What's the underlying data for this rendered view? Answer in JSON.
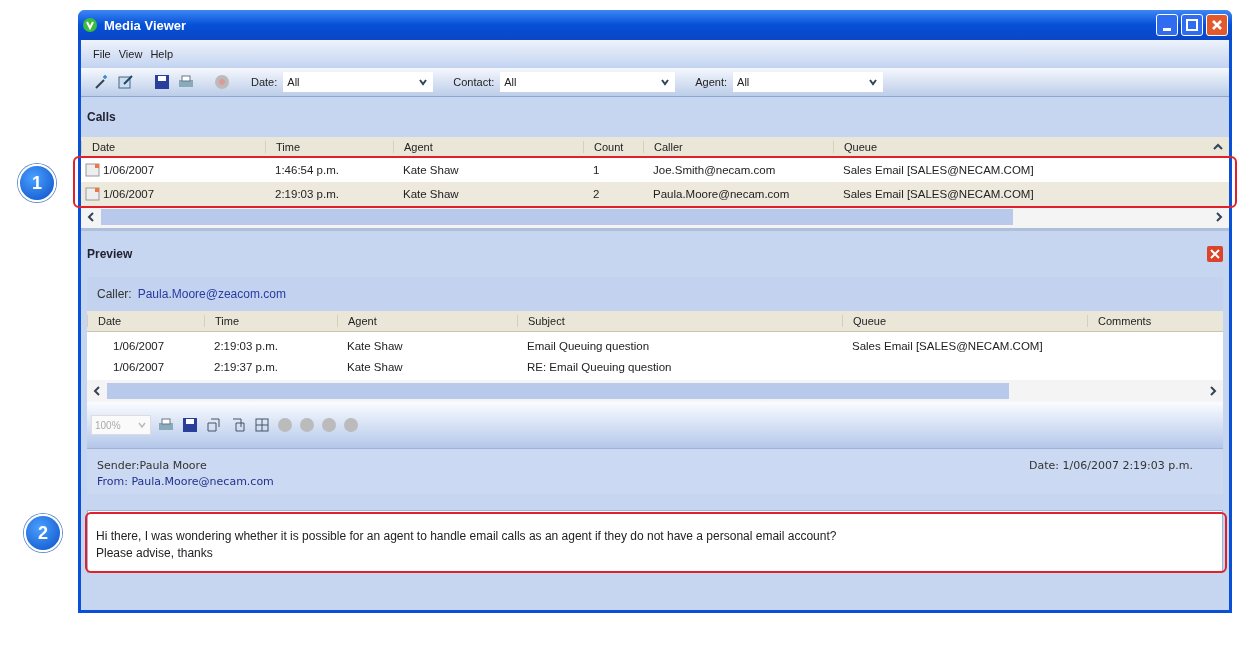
{
  "window": {
    "title": "Media Viewer"
  },
  "menu": [
    "File",
    "View",
    "Help"
  ],
  "filters": [
    {
      "label": "Date:",
      "value": "All"
    },
    {
      "label": "Contact:",
      "value": "All"
    },
    {
      "label": "Agent:",
      "value": "All"
    }
  ],
  "calls": {
    "title": "Calls",
    "columns": [
      "Date",
      "Time",
      "Agent",
      "Count",
      "Caller",
      "Queue"
    ],
    "rows": [
      [
        "1/06/2007",
        "1:46:54 p.m.",
        "Kate Shaw",
        "1",
        "Joe.Smith@necam.com",
        "Sales Email [SALES@NECAM.COM]"
      ],
      [
        "1/06/2007",
        "2:19:03 p.m.",
        "Kate Shaw",
        "2",
        "Paula.Moore@necam.com",
        "Sales Email [SALES@NECAM.COM]"
      ]
    ],
    "callout": "1"
  },
  "preview": {
    "title": "Preview",
    "caller_label": "Caller:",
    "caller": "Paula.Moore@zeacom.com",
    "columns": [
      "Date",
      "Time",
      "Agent",
      "Subject",
      "Queue",
      "Comments"
    ],
    "rows": [
      [
        "1/06/2007",
        "2:19:03 p.m.",
        "Kate Shaw",
        "Email Queuing question",
        "Sales Email [SALES@NECAM.COM]",
        ""
      ],
      [
        "1/06/2007",
        "2:19:37 p.m.",
        "Kate Shaw",
        "RE: Email Queuing question",
        "",
        ""
      ]
    ],
    "zoom": "100%",
    "sender": "Sender:Paula Moore",
    "date": "Date: 1/06/2007 2:19:03 p.m.",
    "from": "From: Paula.Moore@necam.com",
    "message": [
      "Hi there, I was wondering whether it is possible for an agent to handle email calls as an agent if they do not have a personal email account?",
      "Please advise, thanks"
    ],
    "callout": "2"
  }
}
